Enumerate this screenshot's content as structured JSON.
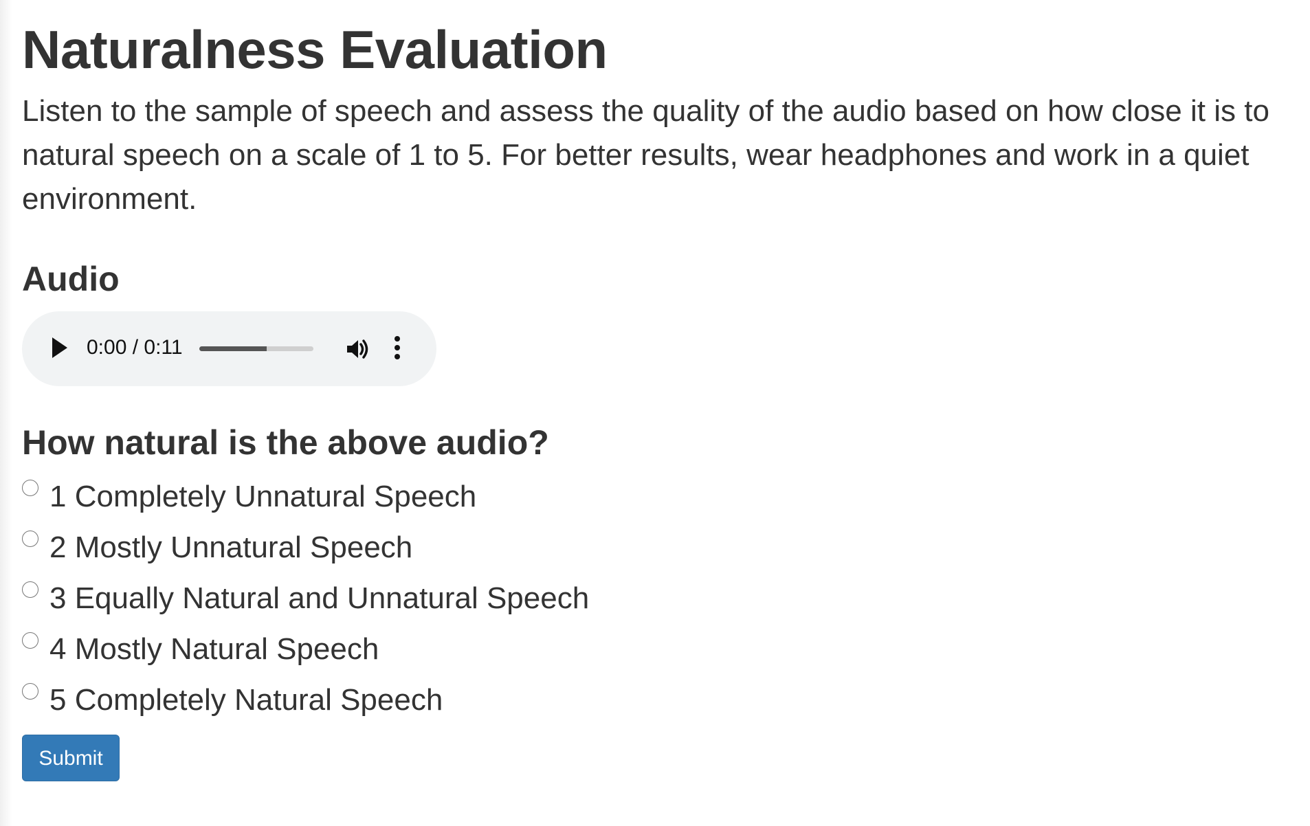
{
  "page": {
    "title": "Naturalness Evaluation",
    "instructions": "Listen to the sample of speech and assess the quality of the audio based on how close it is to natural speech on a scale of 1 to 5. For better results, wear headphones and work in a quiet environment."
  },
  "audio": {
    "heading": "Audio",
    "time_display": "0:00 / 0:11",
    "progress_fraction": 0.59,
    "icons": {
      "play": "play-icon",
      "volume": "volume-icon",
      "menu": "more-options-icon"
    }
  },
  "question": {
    "heading": "How natural is the above audio?",
    "options": [
      {
        "label": "1 Completely Unnatural Speech",
        "value": "1",
        "selected": false
      },
      {
        "label": "2 Mostly Unnatural Speech",
        "value": "2",
        "selected": false
      },
      {
        "label": "3 Equally Natural and Unnatural Speech",
        "value": "3",
        "selected": false
      },
      {
        "label": "4 Mostly Natural Speech",
        "value": "4",
        "selected": false
      },
      {
        "label": "5 Completely Natural Speech",
        "value": "5",
        "selected": false
      }
    ]
  },
  "form": {
    "submit_label": "Submit"
  },
  "colors": {
    "primary_button": "#337ab7",
    "text": "#333333",
    "player_background": "#f1f3f4"
  }
}
